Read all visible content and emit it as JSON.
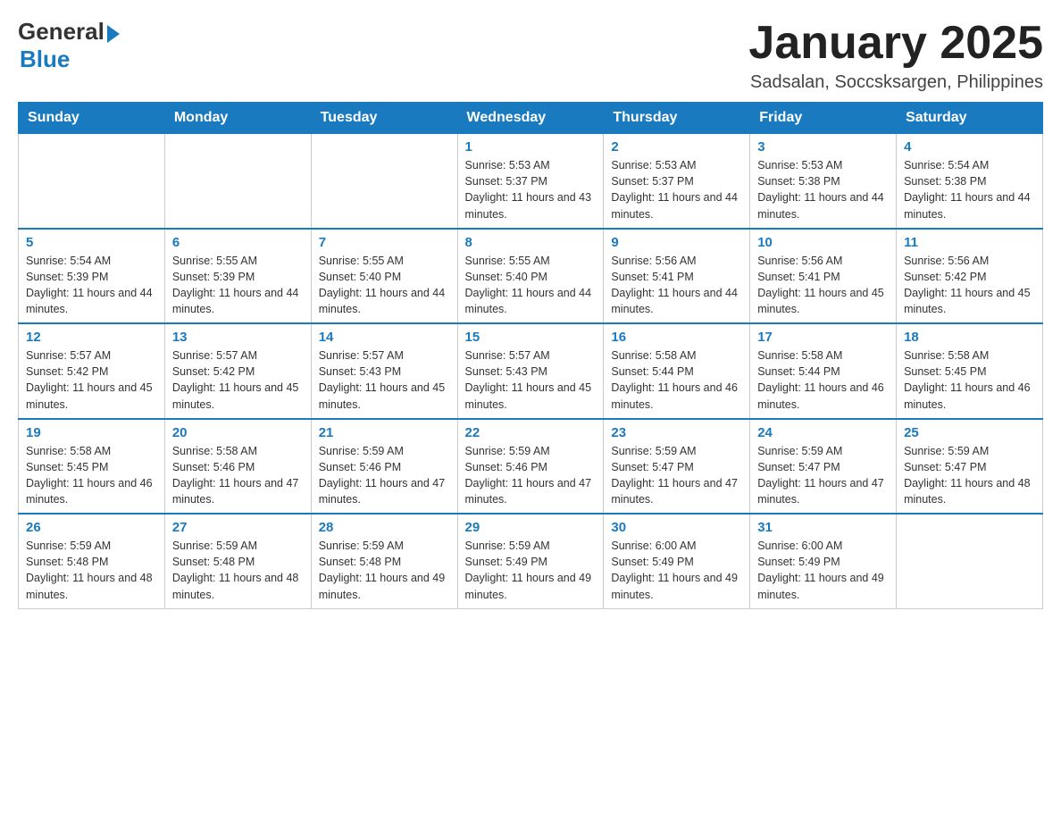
{
  "header": {
    "logo_general": "General",
    "logo_blue": "Blue",
    "month_title": "January 2025",
    "location": "Sadsalan, Soccsksargen, Philippines"
  },
  "weekdays": [
    "Sunday",
    "Monday",
    "Tuesday",
    "Wednesday",
    "Thursday",
    "Friday",
    "Saturday"
  ],
  "weeks": [
    [
      {
        "day": "",
        "info": ""
      },
      {
        "day": "",
        "info": ""
      },
      {
        "day": "",
        "info": ""
      },
      {
        "day": "1",
        "info": "Sunrise: 5:53 AM\nSunset: 5:37 PM\nDaylight: 11 hours and 43 minutes."
      },
      {
        "day": "2",
        "info": "Sunrise: 5:53 AM\nSunset: 5:37 PM\nDaylight: 11 hours and 44 minutes."
      },
      {
        "day": "3",
        "info": "Sunrise: 5:53 AM\nSunset: 5:38 PM\nDaylight: 11 hours and 44 minutes."
      },
      {
        "day": "4",
        "info": "Sunrise: 5:54 AM\nSunset: 5:38 PM\nDaylight: 11 hours and 44 minutes."
      }
    ],
    [
      {
        "day": "5",
        "info": "Sunrise: 5:54 AM\nSunset: 5:39 PM\nDaylight: 11 hours and 44 minutes."
      },
      {
        "day": "6",
        "info": "Sunrise: 5:55 AM\nSunset: 5:39 PM\nDaylight: 11 hours and 44 minutes."
      },
      {
        "day": "7",
        "info": "Sunrise: 5:55 AM\nSunset: 5:40 PM\nDaylight: 11 hours and 44 minutes."
      },
      {
        "day": "8",
        "info": "Sunrise: 5:55 AM\nSunset: 5:40 PM\nDaylight: 11 hours and 44 minutes."
      },
      {
        "day": "9",
        "info": "Sunrise: 5:56 AM\nSunset: 5:41 PM\nDaylight: 11 hours and 44 minutes."
      },
      {
        "day": "10",
        "info": "Sunrise: 5:56 AM\nSunset: 5:41 PM\nDaylight: 11 hours and 45 minutes."
      },
      {
        "day": "11",
        "info": "Sunrise: 5:56 AM\nSunset: 5:42 PM\nDaylight: 11 hours and 45 minutes."
      }
    ],
    [
      {
        "day": "12",
        "info": "Sunrise: 5:57 AM\nSunset: 5:42 PM\nDaylight: 11 hours and 45 minutes."
      },
      {
        "day": "13",
        "info": "Sunrise: 5:57 AM\nSunset: 5:42 PM\nDaylight: 11 hours and 45 minutes."
      },
      {
        "day": "14",
        "info": "Sunrise: 5:57 AM\nSunset: 5:43 PM\nDaylight: 11 hours and 45 minutes."
      },
      {
        "day": "15",
        "info": "Sunrise: 5:57 AM\nSunset: 5:43 PM\nDaylight: 11 hours and 45 minutes."
      },
      {
        "day": "16",
        "info": "Sunrise: 5:58 AM\nSunset: 5:44 PM\nDaylight: 11 hours and 46 minutes."
      },
      {
        "day": "17",
        "info": "Sunrise: 5:58 AM\nSunset: 5:44 PM\nDaylight: 11 hours and 46 minutes."
      },
      {
        "day": "18",
        "info": "Sunrise: 5:58 AM\nSunset: 5:45 PM\nDaylight: 11 hours and 46 minutes."
      }
    ],
    [
      {
        "day": "19",
        "info": "Sunrise: 5:58 AM\nSunset: 5:45 PM\nDaylight: 11 hours and 46 minutes."
      },
      {
        "day": "20",
        "info": "Sunrise: 5:58 AM\nSunset: 5:46 PM\nDaylight: 11 hours and 47 minutes."
      },
      {
        "day": "21",
        "info": "Sunrise: 5:59 AM\nSunset: 5:46 PM\nDaylight: 11 hours and 47 minutes."
      },
      {
        "day": "22",
        "info": "Sunrise: 5:59 AM\nSunset: 5:46 PM\nDaylight: 11 hours and 47 minutes."
      },
      {
        "day": "23",
        "info": "Sunrise: 5:59 AM\nSunset: 5:47 PM\nDaylight: 11 hours and 47 minutes."
      },
      {
        "day": "24",
        "info": "Sunrise: 5:59 AM\nSunset: 5:47 PM\nDaylight: 11 hours and 47 minutes."
      },
      {
        "day": "25",
        "info": "Sunrise: 5:59 AM\nSunset: 5:47 PM\nDaylight: 11 hours and 48 minutes."
      }
    ],
    [
      {
        "day": "26",
        "info": "Sunrise: 5:59 AM\nSunset: 5:48 PM\nDaylight: 11 hours and 48 minutes."
      },
      {
        "day": "27",
        "info": "Sunrise: 5:59 AM\nSunset: 5:48 PM\nDaylight: 11 hours and 48 minutes."
      },
      {
        "day": "28",
        "info": "Sunrise: 5:59 AM\nSunset: 5:48 PM\nDaylight: 11 hours and 49 minutes."
      },
      {
        "day": "29",
        "info": "Sunrise: 5:59 AM\nSunset: 5:49 PM\nDaylight: 11 hours and 49 minutes."
      },
      {
        "day": "30",
        "info": "Sunrise: 6:00 AM\nSunset: 5:49 PM\nDaylight: 11 hours and 49 minutes."
      },
      {
        "day": "31",
        "info": "Sunrise: 6:00 AM\nSunset: 5:49 PM\nDaylight: 11 hours and 49 minutes."
      },
      {
        "day": "",
        "info": ""
      }
    ]
  ]
}
